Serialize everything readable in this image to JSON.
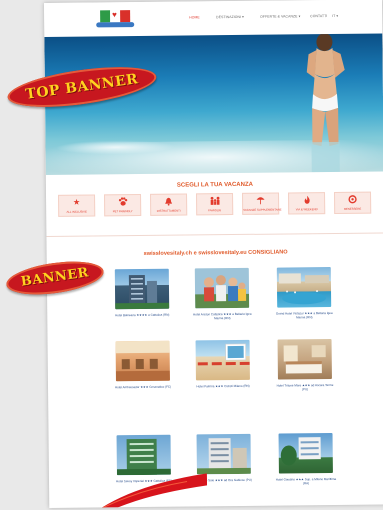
{
  "nav": {
    "items": [
      "HOME",
      "DESTINAZIONI ▾",
      "OFFERTE & VACANZE ▾",
      "CONTATTI",
      "IT ▾"
    ]
  },
  "categories": {
    "title": "SCEGLI LA TUA VACANZA",
    "items": [
      {
        "icon": "star-icon",
        "glyph": "★",
        "label": "ALL INCLUSIVE"
      },
      {
        "icon": "paw-icon",
        "glyph": "🐾",
        "label": "PET FRIENDLY"
      },
      {
        "icon": "bell-icon",
        "glyph": "🔔",
        "label": "DISTRATTAMENTI"
      },
      {
        "icon": "family-icon",
        "glyph": "👪",
        "label": "FAMIGLIE"
      },
      {
        "icon": "beach-umbrella-icon",
        "glyph": "⛱",
        "label": "VACANZE SUPPLEMENTARE"
      },
      {
        "icon": "fire-icon",
        "glyph": "🔥",
        "label": "VIA & WEEKEND"
      },
      {
        "icon": "settings-icon",
        "glyph": "✺",
        "label": "BENESSERE"
      }
    ]
  },
  "recommend": {
    "title": "swisslovesitaly.ch e swisslovesitaly.eu CONSIGLIANO",
    "hotels": [
      {
        "caption": "Hotel Balnearia ★★★★ a Cattolica (RN)"
      },
      {
        "caption": "Hotel Ariston Cattolica ★★★ a Bellaria Igea Marina (RN)"
      },
      {
        "caption": "Grand Hotel Vistazur ★★★ a Bellaria Igea Marina (RN)"
      },
      {
        "caption": "Hotel Ambassador ★★★ Cesenatico (FC)"
      },
      {
        "caption": "Hotel Palmira ★★★ Ciclisti Milano (RN)"
      },
      {
        "caption": "Hotel Tritone Mare ★★★ ad Ascara Terme (PU)"
      },
      {
        "caption": "Hotel Savoy Imperial ★★★ Cattolica (FC)"
      },
      {
        "caption": "Hotel Lo Sole ★★★ ad Ora Gabicce (PU)"
      },
      {
        "caption": "Hotel Giardino ★★★ Sup. a Milano Marittima (RA)"
      }
    ]
  },
  "overlays": {
    "top": "TOP BANNER",
    "mid": "BANNER"
  },
  "colors": {
    "accent": "#e03a2e",
    "banner_red": "#c7171f",
    "banner_text": "#ffd21f"
  }
}
